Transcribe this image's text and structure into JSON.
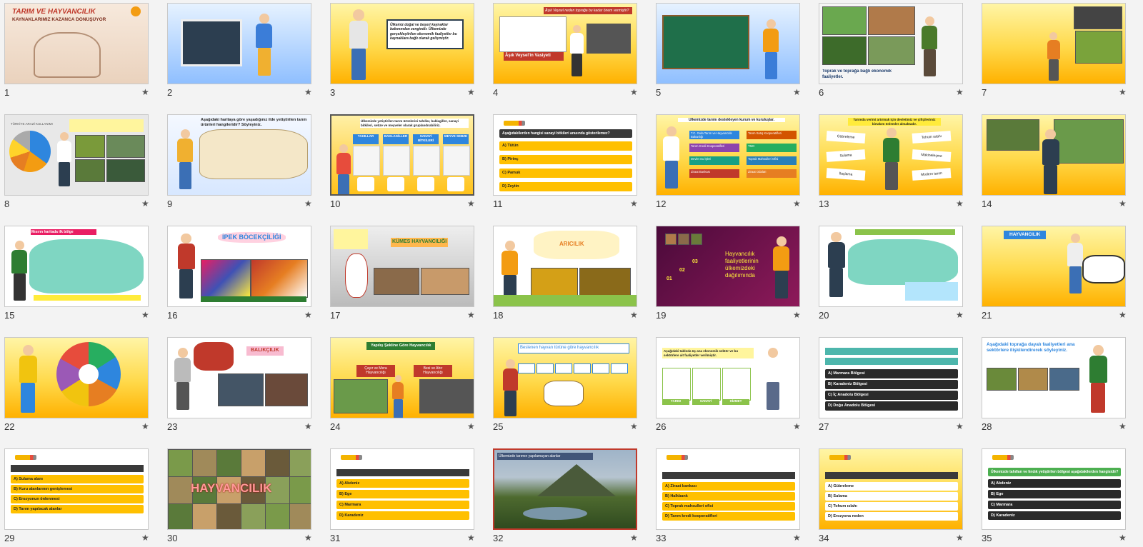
{
  "viewer": {
    "layout": "slide-sorter",
    "colors": {
      "background": "#f3f3f3",
      "selected_border": "#c0392b",
      "accent_yellow": "#ffc000"
    }
  },
  "slides": [
    {
      "n": "1",
      "title": "TARIM VE HAYVANCILIK",
      "subtitle": "KAYNAKLARIMIZ KAZANCA DÖNÜŞÜYOR"
    },
    {
      "n": "2"
    },
    {
      "n": "3",
      "text": "Ülkemiz doğal ve beşeri kaynaklar bakımından zengindir. Ülkemizde gerçekleştirilen ekonomik faaliyetler bu kaynaklara bağlı olarak gelişmiştir."
    },
    {
      "n": "4",
      "header": "Âşık Veysel neden toprağa bu kadar önem vermiştir?",
      "footer": "Âşık Veysel'in Vasiyeti"
    },
    {
      "n": "5"
    },
    {
      "n": "6",
      "caption": "Toprak ve toprağa bağlı ekonomik faaliyetler."
    },
    {
      "n": "7"
    },
    {
      "n": "8",
      "chart_title": "TÜRKİYE ARAZİ KULLANIMI"
    },
    {
      "n": "9",
      "title": "Aşağıdaki haritaya göre yaşadığınız ilde yetiştirilen tarım ürünleri hangileridir? Söyleyiniz."
    },
    {
      "n": "10",
      "title": "Ülkemizde yetiştirilen tarım ürünlerini tahıllar, baklagiller, sanayi bitkileri, sebze ve meyveler olarak gruplandırabiliriz.",
      "cols": [
        "TAHILLAR",
        "BAKLAGİLLER",
        "SANAYİ BİTKİLERİ",
        "MEYVE SEBZE"
      ]
    },
    {
      "n": "11",
      "question": "Aşağıdakilerden hangisi sanayi bitkileri arasında gösterilemez?",
      "options": [
        "A) Tütün",
        "B) Pirinç",
        "C) Pamuk",
        "D) Zeytin"
      ]
    },
    {
      "n": "12",
      "title": "Ülkemizde tarımı destekleyen kurum ve kuruluşlar.",
      "items": [
        "T.C. Gıda Tarım ve Hayvancılık Bakanlığı",
        "Tarım Kredi Kooperatifleri",
        "Devlet Su İşleri",
        "Ziraat Bankası",
        "Tarım Satış Kooperatifleri",
        "TMO",
        "Toprak Mahsulleri Ofisi",
        "Ziraat Odaları"
      ]
    },
    {
      "n": "13",
      "title": "Tarımda verimi artırmak için devletimiz ve çiftçilerimiz birtakım önlemler almaktadır.",
      "items": [
        "Gübreleme",
        "Sulama",
        "İlaçlama",
        "Tohum ıslahı",
        "Makineleşme",
        "Modern tarım"
      ]
    },
    {
      "n": "14"
    },
    {
      "n": "15",
      "title": "Mısırın haritada ilk bölge"
    },
    {
      "n": "16",
      "title": "İPEK BÖCEKÇİLİĞİ"
    },
    {
      "n": "17",
      "title": "KÜMES HAYVANCILIĞI"
    },
    {
      "n": "18",
      "title": "ARICILIK"
    },
    {
      "n": "19",
      "title": "Hayvancılık faaliyetlerinin ülkemizdeki dağılımında",
      "steps": [
        "01",
        "02",
        "03"
      ]
    },
    {
      "n": "20"
    },
    {
      "n": "21",
      "title": "HAYVANCILIK"
    },
    {
      "n": "22"
    },
    {
      "n": "23",
      "title": "BALIKÇILIK"
    },
    {
      "n": "24",
      "title": "Yapılış Şekline Göre Hayvancılık",
      "left": "Çayır ve Mera Hayvancılığı",
      "right": "Besi ve Ahır Hayvancılığı"
    },
    {
      "n": "25",
      "title": "Beslenen hayvan türüne göre hayvancılık"
    },
    {
      "n": "26",
      "title": "Aşağıdaki tabloda üç ana ekonomik sektör ve bu sektörlere ait faaliyetler verilmiştir.",
      "cols": [
        "TARIM",
        "SANAYİ",
        "HİZMET"
      ]
    },
    {
      "n": "27",
      "options": [
        "A) Marmara Bölgesi",
        "B) Karadeniz Bölgesi",
        "C) İç Anadolu Bölgesi",
        "D) Doğu Anadolu Bölgesi"
      ]
    },
    {
      "n": "28",
      "title": "Aşağıdaki toprağa dayalı faaliyetleri ana sektörlere ilişkilendirerek söyleyiniz."
    },
    {
      "n": "29",
      "options": [
        "A) Sulama alanı",
        "B) Kuru alanlarının genişlemesi",
        "C) Erozyonun önlenmesi",
        "D) Tarım yapılacak alanlar"
      ]
    },
    {
      "n": "30",
      "title": "HAYVANCILIK"
    },
    {
      "n": "31",
      "options": [
        "A) Akdeniz",
        "B) Ege",
        "C) Marmara",
        "D) Karadeniz"
      ]
    },
    {
      "n": "32",
      "caption": "Ülkemizde tarımın yapılamayan alanlar"
    },
    {
      "n": "33",
      "options": [
        "A) Ziraat bankası",
        "B) Halkbank",
        "C) Toprak mahsulleri ofisi",
        "D) Tarım kredi kooperatifleri"
      ]
    },
    {
      "n": "34",
      "options": [
        "A) Gübreleme",
        "B) Sulama",
        "C) Tohum ıslahı",
        "D) Erozyona neden"
      ]
    },
    {
      "n": "35",
      "question": "Ülkemizde tahılları ve fındık yetiştirilen bölgesi aşağıdakilerden hangisidir?",
      "options": [
        "A) Akdeniz",
        "B) Ege",
        "C) Marmara",
        "D) Karadeniz"
      ]
    }
  ]
}
